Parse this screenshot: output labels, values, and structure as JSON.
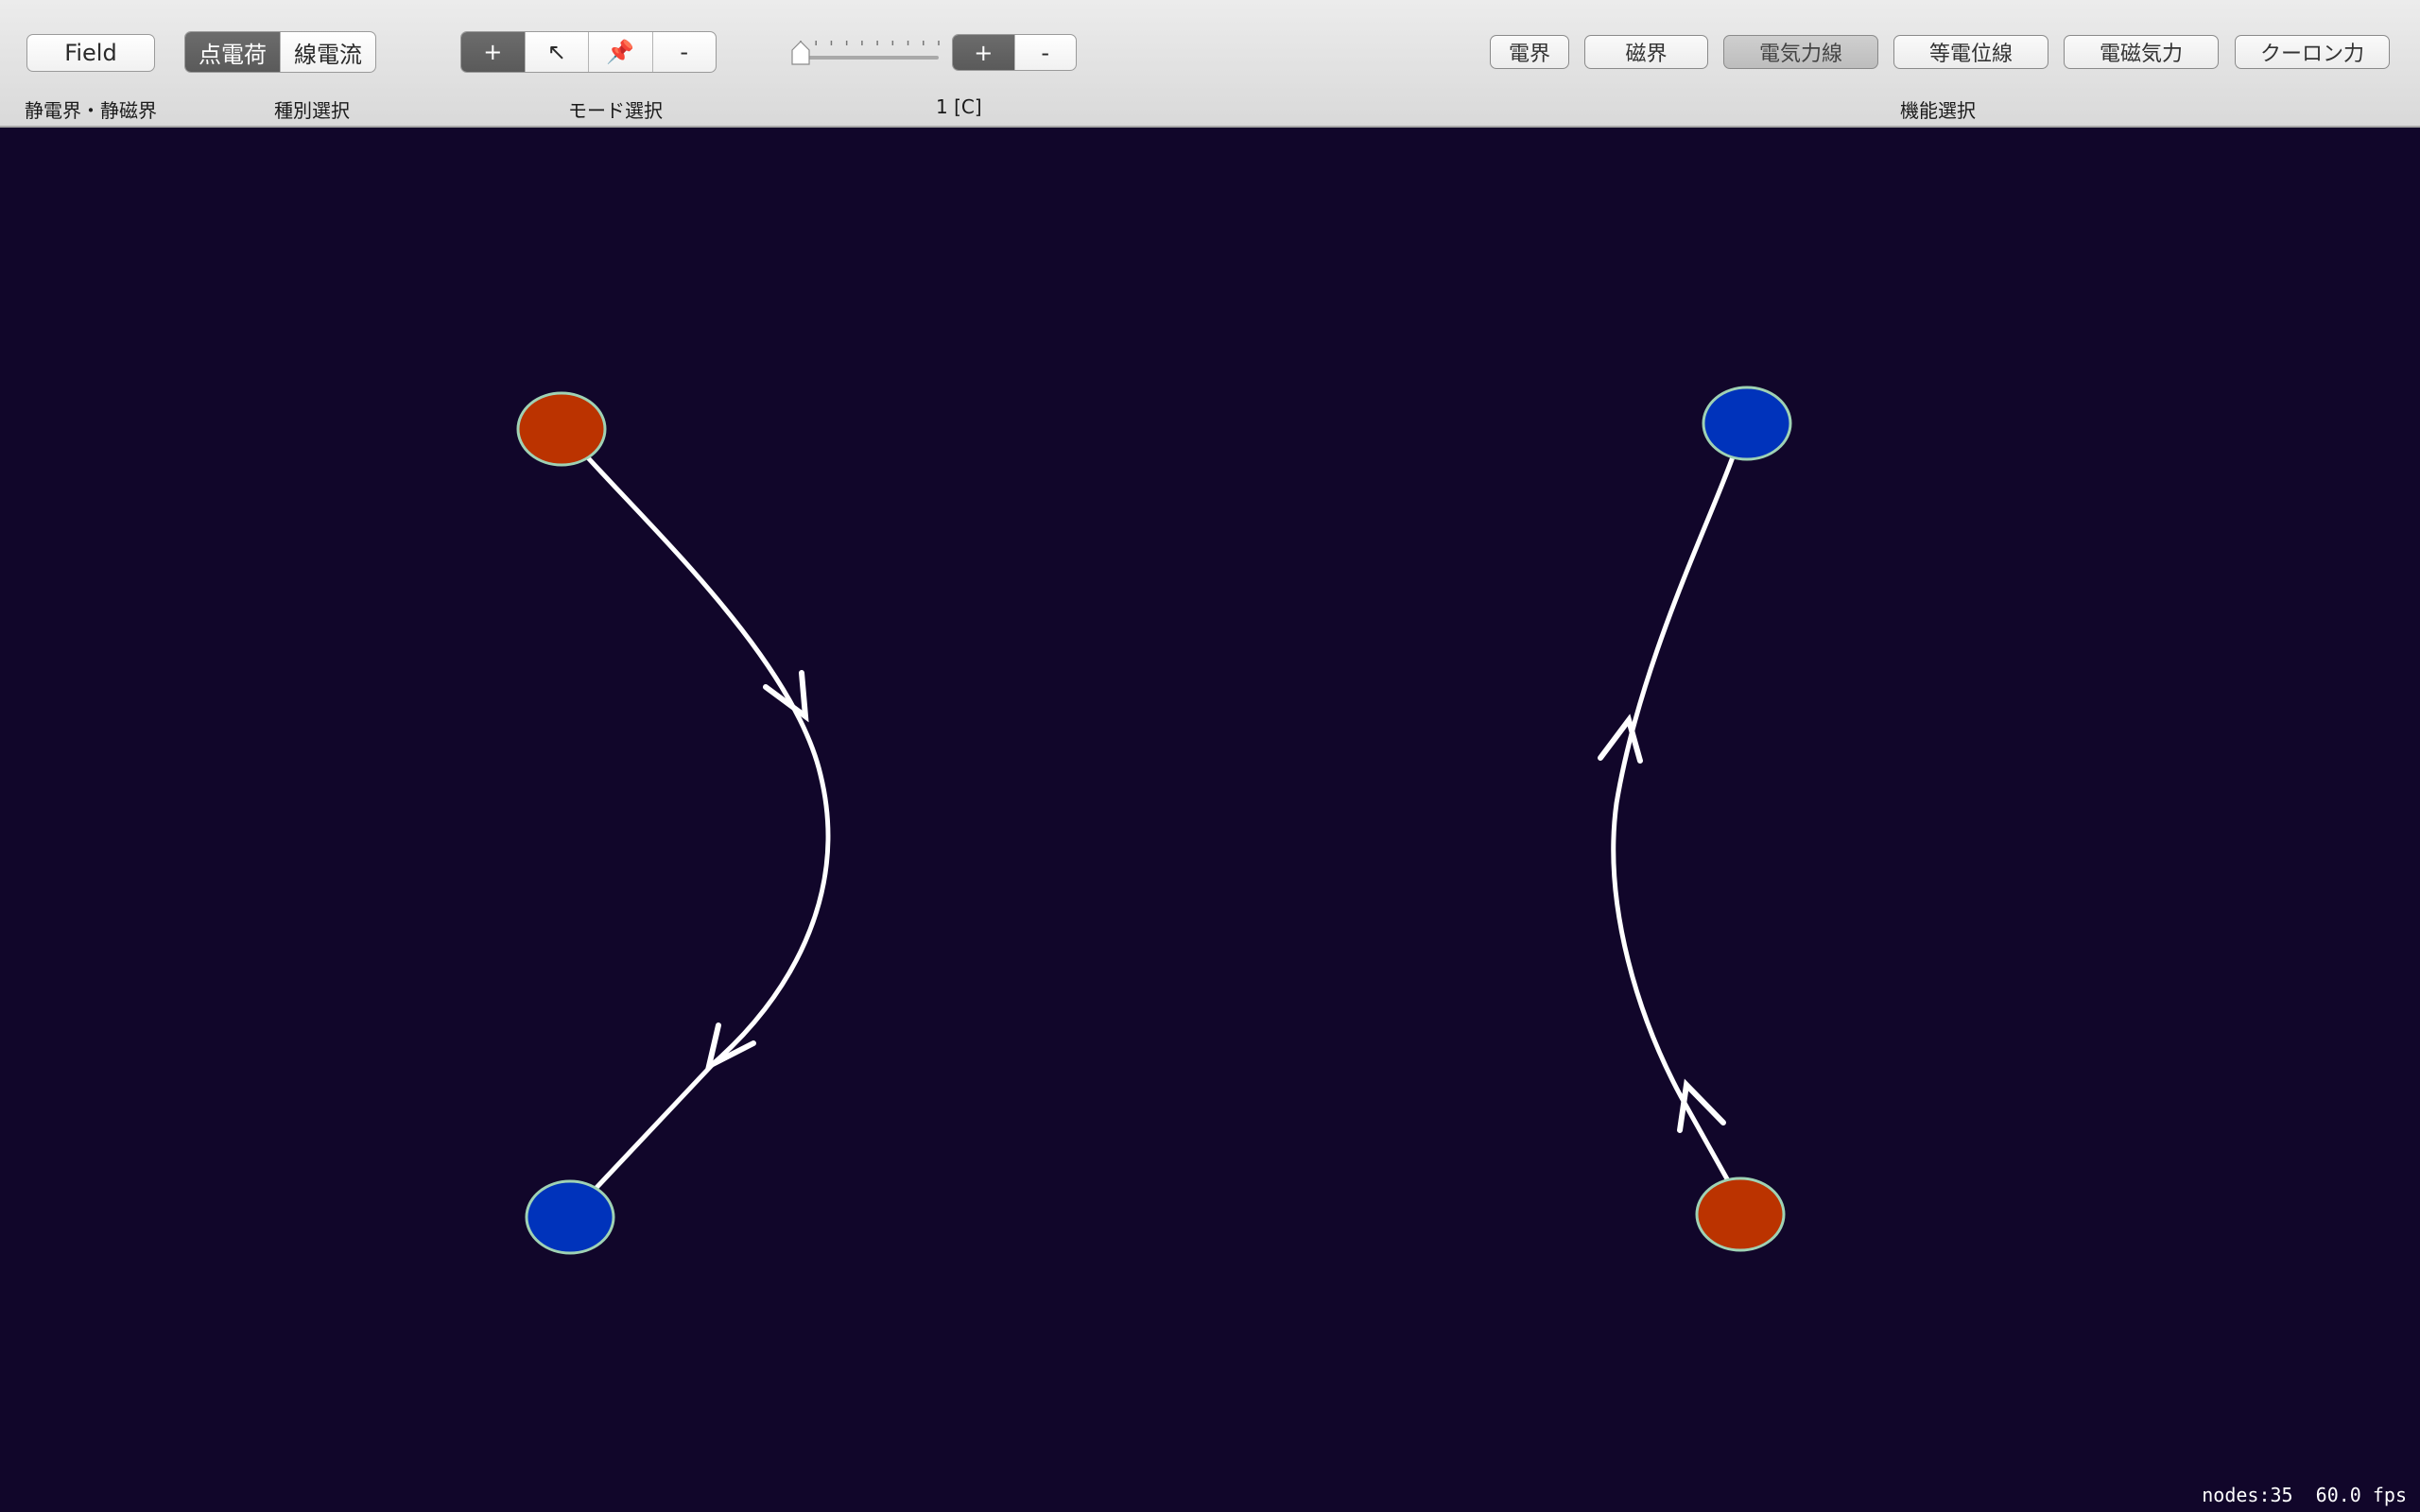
{
  "toolbar": {
    "mode_button": "Field",
    "type_segment": {
      "items": [
        "点電荷",
        "線電流"
      ],
      "selected": 0
    },
    "tool_segment": {
      "items": [
        "+",
        "↖",
        "📌",
        "-"
      ],
      "icons": [
        "plus-icon",
        "select-arrow-icon",
        "pin-icon",
        "minus-icon"
      ],
      "selected": 0
    },
    "sign_segment": {
      "items": [
        "+",
        "-"
      ],
      "selected": 0
    },
    "magnitude_slider": {
      "value": 0.0,
      "ticks": 10
    },
    "feature_buttons": [
      {
        "label": "電界",
        "active": false
      },
      {
        "label": "磁界",
        "active": false
      },
      {
        "label": "電気力線",
        "active": true
      },
      {
        "label": "等電位線",
        "active": false
      },
      {
        "label": "電磁気力",
        "active": false
      },
      {
        "label": "クーロン力",
        "active": false
      }
    ],
    "labels": {
      "field_mode": "静電界・静磁界",
      "type_select": "種別選択",
      "mode_select": "モード選択",
      "magnitude": "1 [C]",
      "feature_select": "機能選択"
    }
  },
  "colors": {
    "background": "#11062a",
    "positive_charge": "#bb3300",
    "negative_charge": "#0033bb",
    "charge_outline": "#9fd2b4",
    "field_line": "#ffffff"
  },
  "status": {
    "nodes": "nodes:35",
    "fps": "60.0 fps"
  }
}
